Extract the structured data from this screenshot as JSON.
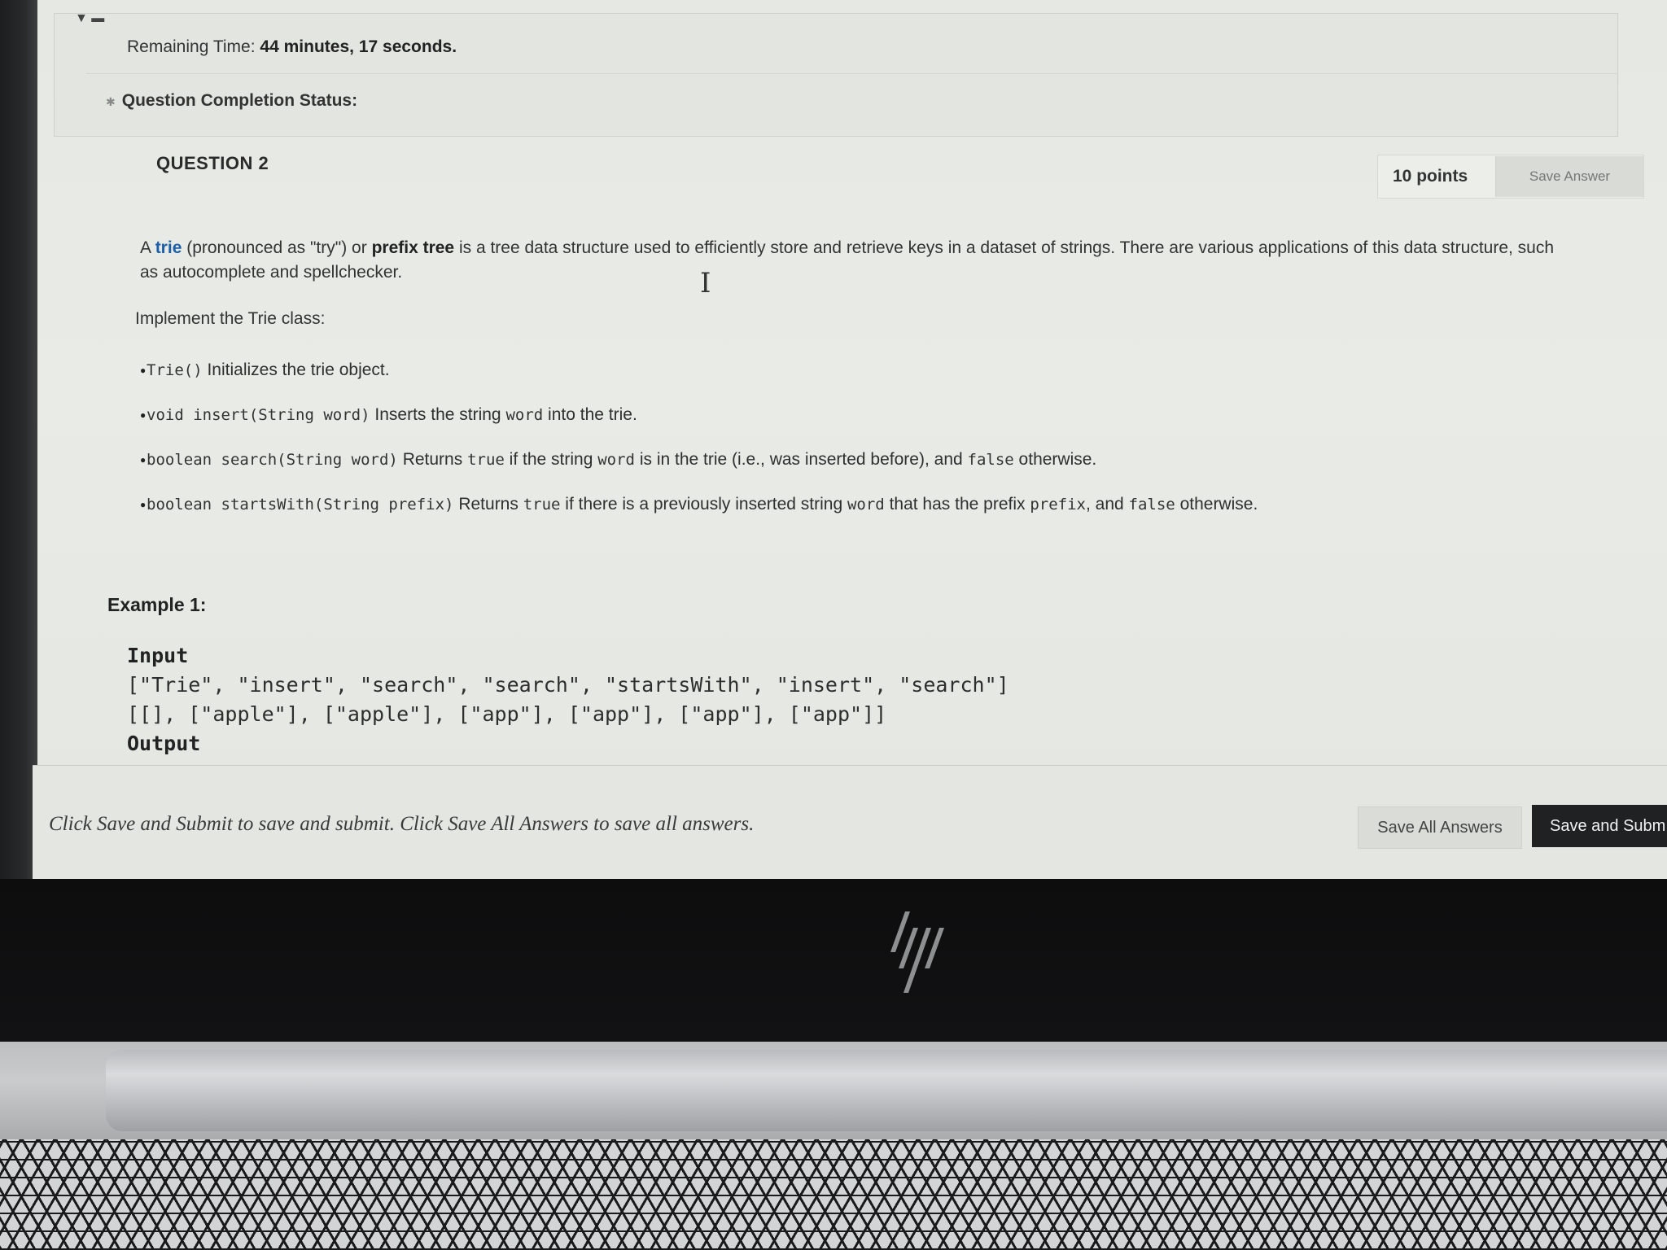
{
  "status": {
    "remaining_label": "Remaining Time:",
    "minutes": "44",
    "minutes_label": "minutes,",
    "seconds": "17",
    "seconds_label": "seconds.",
    "completion_label": "Question Completion Status:"
  },
  "question": {
    "title": "QUESTION 2",
    "points": "10 points",
    "save_answer": "Save Answer"
  },
  "description": {
    "p1_a": "A ",
    "trie": "trie",
    "p1_b": " (pronounced as \"try\") or ",
    "prefix_tree": "prefix tree",
    "p1_c": " is a tree data structure used to efficiently store and retrieve keys in a dataset of strings. There are various applications of this data structure, such as autocomplete and spellchecker.",
    "implement": "Implement the Trie class:"
  },
  "methods": [
    {
      "code": "Trie()",
      "text": " Initializes the trie object."
    },
    {
      "code": "void insert(String word)",
      "text_a": " Inserts the string ",
      "code2": "word",
      "text_b": " into the trie."
    },
    {
      "code": "boolean search(String word)",
      "text_a": " Returns ",
      "code2": "true",
      "text_b": " if the string ",
      "code3": "word",
      "text_c": " is in the trie (i.e., was inserted before), and ",
      "code4": "false",
      "text_d": " otherwise."
    },
    {
      "code": "boolean startsWith(String prefix)",
      "text_a": " Returns ",
      "code2": "true",
      "text_b": " if there is a previously inserted string ",
      "code3": "word",
      "text_c": " that has the prefix ",
      "code4": "prefix",
      "text_d": ", and ",
      "code5": "false",
      "text_e": " otherwise."
    }
  ],
  "example": {
    "title": "Example 1:",
    "input_label": "Input",
    "line1": "[\"Trie\", \"insert\", \"search\", \"search\", \"startsWith\", \"insert\", \"search\"]",
    "line2": "[[], [\"apple\"], [\"apple\"], [\"app\"], [\"app\"], [\"app\"], [\"app\"]]",
    "output_label": "Output"
  },
  "footer": {
    "note": "Click Save and Submit to save and submit. Click Save All Answers to save all answers.",
    "save_all": "Save All Answers",
    "save_submit": "Save and Subm"
  },
  "icons": {
    "collapse": "triangle-down-icon",
    "cursor": "text-cursor-icon",
    "brand": "hp-logo"
  }
}
